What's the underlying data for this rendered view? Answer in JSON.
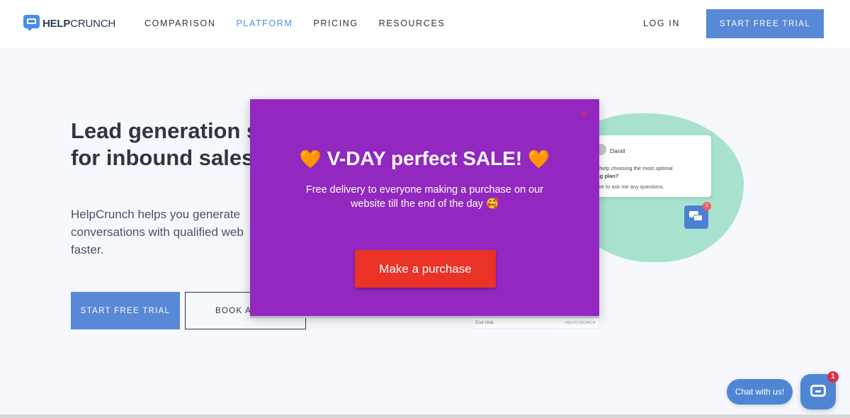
{
  "header": {
    "logo": {
      "bold": "HELP",
      "regular": "CRUNCH"
    },
    "nav": [
      {
        "label": "COMPARISON"
      },
      {
        "label": "PLATFORM",
        "active": true
      },
      {
        "label": "PRICING"
      },
      {
        "label": "RESOURCES"
      }
    ],
    "login": "LOG IN",
    "cta": "START FREE TRIAL"
  },
  "hero": {
    "title_line1": "Lead generation se",
    "title_line2": "for inbound sales",
    "subtitle_line1": "HelpCrunch helps you generate",
    "subtitle_line2": "conversations with qualified web",
    "subtitle_line3": "faster.",
    "cta_primary": "START FREE TRIAL",
    "cta_secondary": "BOOK A"
  },
  "illustration": {
    "agent_name": "Daniil",
    "message_line1": "d help choosing the most optimal",
    "message_line2": "ing plan?",
    "note": "free to ask me any questions.",
    "badge_count": "1",
    "end_chat": "End chat",
    "brand": "HELPCRUNCH"
  },
  "popup": {
    "close": "×",
    "heart": "🧡",
    "title": "V-DAY perfect SALE!",
    "description": "Free delivery to everyone making a purchase on our website till the end of the day 🥰",
    "cta": "Make a purchase"
  },
  "chat_widget": {
    "bubble": "Chat with us!",
    "badge": "1"
  },
  "colors": {
    "accent": "#5989d6",
    "popup_bg": "#9228c0",
    "popup_cta": "#ea3226",
    "blob": "#a8e2cf"
  }
}
